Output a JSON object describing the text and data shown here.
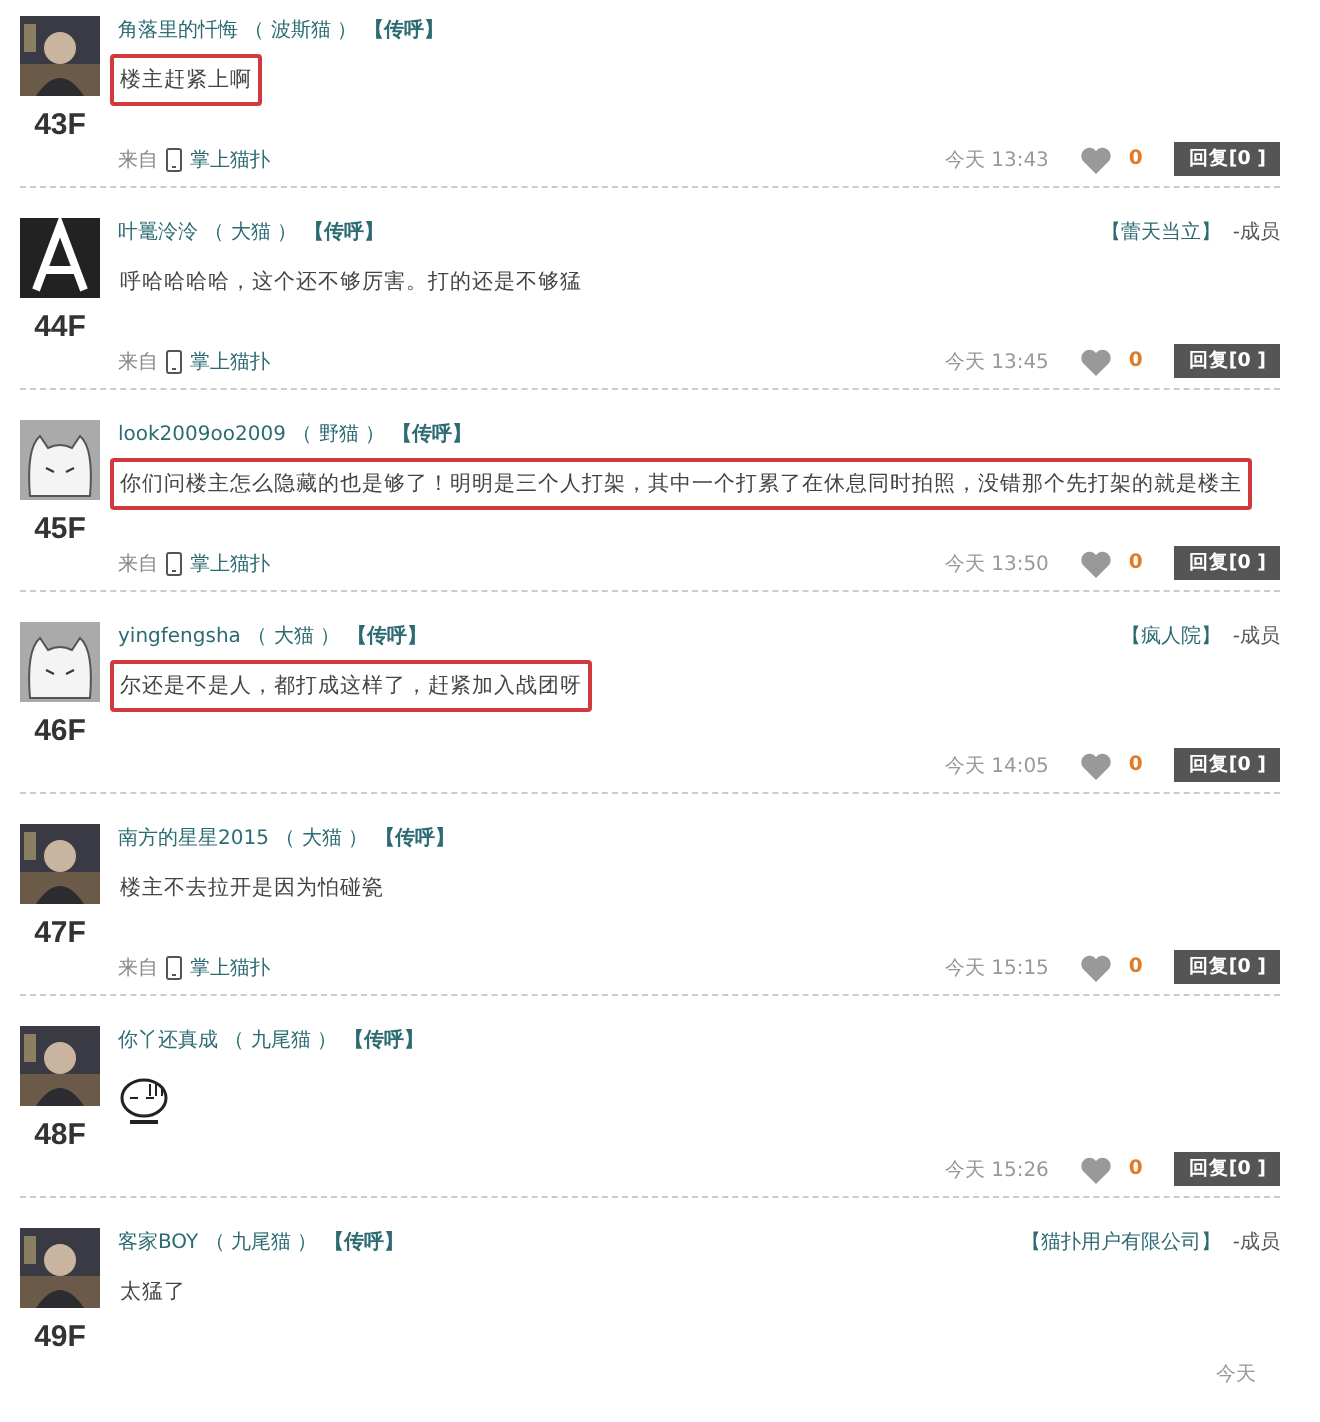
{
  "posts": [
    {
      "floor": "43F",
      "user": "角落里的忏悔",
      "level": "（ 波斯猫 ）",
      "tag": "【传呼】",
      "body": {
        "kind": "text",
        "text": "楼主赶紧上啊"
      },
      "highlighted": true,
      "source": {
        "prefix": "来自",
        "client": "掌上猫扑"
      },
      "time": "今天 13:43",
      "likes": "0",
      "reply": "回复[0 ]"
    },
    {
      "floor": "44F",
      "avatar": {
        "kind": "logo"
      },
      "user": "叶鼍泠泠",
      "level": "（ 大猫 ）",
      "tag": "【传呼】",
      "group": "【蕾天当立】",
      "role": "-成员",
      "body": {
        "kind": "text",
        "text": "呼哈哈哈哈，这个还不够厉害。打的还是不够猛"
      },
      "highlighted": false,
      "source": {
        "prefix": "来自",
        "client": "掌上猫扑"
      },
      "time": "今天 13:45",
      "likes": "0",
      "reply": "回复[0 ]"
    },
    {
      "floor": "45F",
      "avatar": {
        "kind": "cartoon"
      },
      "user": "look2009oo2009",
      "level": "（ 野猫 ）",
      "tag": "【传呼】",
      "body": {
        "kind": "text",
        "text": "你们问楼主怎么隐藏的也是够了！明明是三个人打架，其中一个打累了在休息同时拍照，没错那个先打架的就是楼主"
      },
      "highlighted": true,
      "source": {
        "prefix": "来自",
        "client": "掌上猫扑"
      },
      "time": "今天 13:50",
      "likes": "0",
      "reply": "回复[0 ]"
    },
    {
      "floor": "46F",
      "avatar": {
        "kind": "cartoon"
      },
      "user": "yingfengsha",
      "level": "（ 大猫 ）",
      "tag": "【传呼】",
      "group": "【疯人院】",
      "role": "-成员",
      "body": {
        "kind": "text",
        "text": "尔还是不是人，都打成这样了，赶紧加入战团呀"
      },
      "highlighted": true,
      "time": "今天 14:05",
      "likes": "0",
      "reply": "回复[0 ]"
    },
    {
      "floor": "47F",
      "user": "南方的星星2015",
      "level": "（ 大猫 ）",
      "tag": "【传呼】",
      "body": {
        "kind": "text",
        "text": "楼主不去拉开是因为怕碰瓷"
      },
      "highlighted": false,
      "source": {
        "prefix": "来自",
        "client": "掌上猫扑"
      },
      "time": "今天 15:15",
      "likes": "0",
      "reply": "回复[0 ]"
    },
    {
      "floor": "48F",
      "user": "你丫还真成",
      "level": "（ 九尾猫 ）",
      "tag": "【传呼】",
      "body": {
        "kind": "emoticon"
      },
      "highlighted": false,
      "time": "今天 15:26",
      "likes": "0",
      "reply": "回复[0 ]"
    },
    {
      "floor": "49F",
      "user": "客家BOY",
      "level": "（ 九尾猫 ）",
      "tag": "【传呼】",
      "group": "【猫扑用户有限公司】",
      "role": "-成员",
      "body": {
        "kind": "text",
        "text": "太猛了"
      },
      "highlighted": false,
      "time": "今天"
    }
  ]
}
